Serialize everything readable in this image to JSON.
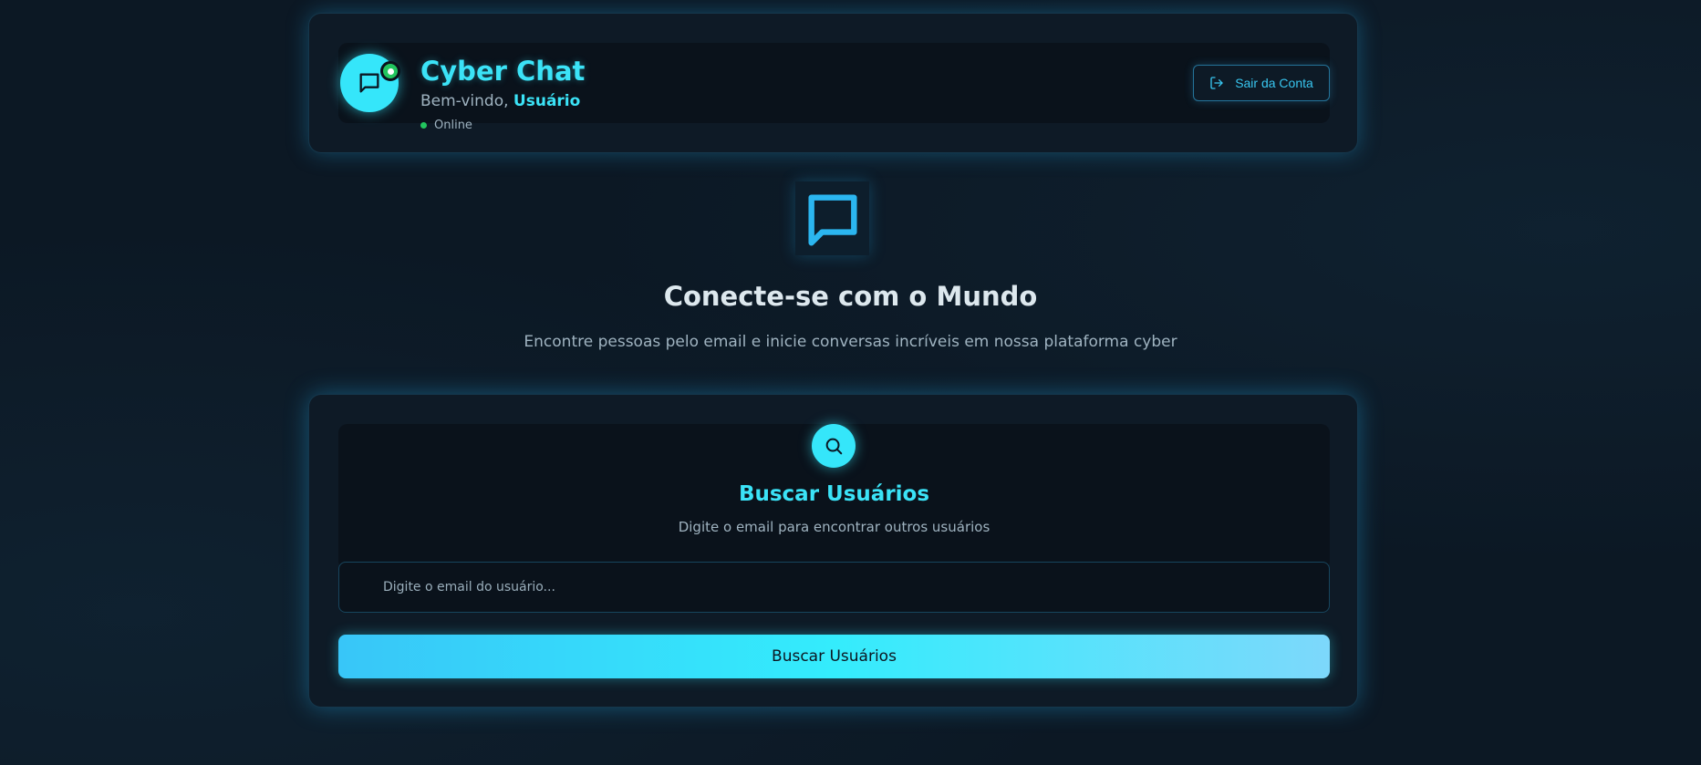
{
  "header": {
    "app_title": "Cyber Chat",
    "welcome_prefix": "Bem-vindo, ",
    "user_name": "Usuário",
    "status": "Online",
    "logout_label": "Sair da Conta"
  },
  "hero": {
    "icon": "chat-bubble-icon",
    "title": "Conecte-se com o Mundo",
    "subtitle": "Encontre pessoas pelo email e inicie conversas incríveis em nossa plataforma cyber"
  },
  "search": {
    "icon": "search-icon",
    "title": "Buscar Usuários",
    "subtitle": "Digite o email para encontrar outros usuários",
    "input_placeholder": "Digite o email do usuário...",
    "input_value": "",
    "button_label": "Buscar Usuários"
  },
  "colors": {
    "accent": "#35e6fa",
    "online": "#22c55e",
    "background": "#0c1824",
    "card": "#0e1a26"
  }
}
